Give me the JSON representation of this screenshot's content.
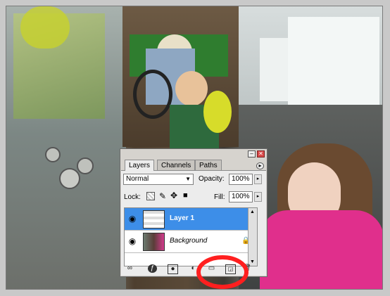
{
  "panel": {
    "tabs": [
      {
        "label": "Layers",
        "active": true
      },
      {
        "label": "Channels",
        "active": false
      },
      {
        "label": "Paths",
        "active": false
      }
    ],
    "blend_mode": "Normal",
    "opacity_label": "Opacity:",
    "opacity_value": "100%",
    "lock_label": "Lock:",
    "fill_label": "Fill:",
    "fill_value": "100%",
    "layers": [
      {
        "name": "Layer 1",
        "selected": true
      },
      {
        "name": "Background",
        "selected": false,
        "locked": true
      }
    ],
    "minimize_glyph": "–",
    "close_glyph": "✕",
    "menu_glyph": "▸"
  },
  "colors": {
    "selection": "#3d8ee8",
    "annotation": "#ff1f1f"
  },
  "icons": [
    "link-icon",
    "fx-icon",
    "mask-icon",
    "adjustment-icon",
    "folder-icon",
    "new-layer-icon",
    "trash-icon"
  ]
}
